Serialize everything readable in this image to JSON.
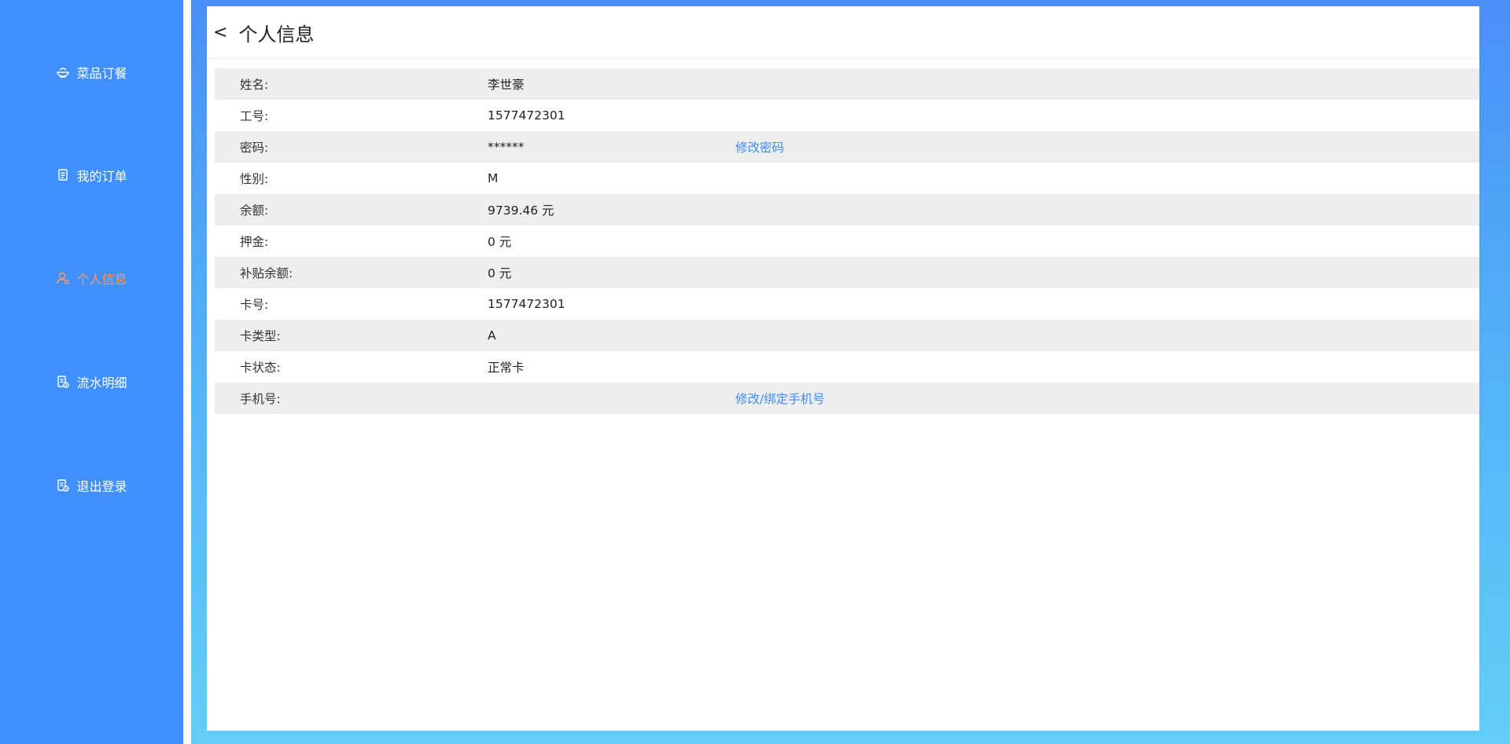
{
  "sidebar": {
    "items": [
      {
        "label": "菜品订餐",
        "icon": "rice-bowl-icon",
        "active": false
      },
      {
        "label": "我的订单",
        "icon": "document-icon",
        "active": false
      },
      {
        "label": "个人信息",
        "icon": "user-icon",
        "active": true
      },
      {
        "label": "流水明细",
        "icon": "bill-icon",
        "active": false
      },
      {
        "label": "退出登录",
        "icon": "logout-icon",
        "active": false
      }
    ],
    "active_color": "#ff9a5a",
    "background": "#4090ff"
  },
  "header": {
    "back": "<",
    "title": "个人信息"
  },
  "profile": {
    "rows": [
      {
        "label": "姓名:",
        "value": "李世豪",
        "action": ""
      },
      {
        "label": "工号:",
        "value": "1577472301",
        "action": ""
      },
      {
        "label": "密码:",
        "value": "******",
        "action": "修改密码"
      },
      {
        "label": "性别:",
        "value": "M",
        "action": ""
      },
      {
        "label": "余额:",
        "value": "9739.46 元",
        "action": ""
      },
      {
        "label": "押金:",
        "value": "0 元",
        "action": ""
      },
      {
        "label": "补贴余额:",
        "value": "0 元",
        "action": ""
      },
      {
        "label": "卡号:",
        "value": "1577472301",
        "action": ""
      },
      {
        "label": "卡类型:",
        "value": "A",
        "action": ""
      },
      {
        "label": "卡状态:",
        "value": "正常卡",
        "action": ""
      },
      {
        "label": "手机号:",
        "value": "",
        "action": "修改/绑定手机号"
      }
    ]
  },
  "colors": {
    "link": "#3f8cf0",
    "row_alt": "#eeeeee"
  }
}
